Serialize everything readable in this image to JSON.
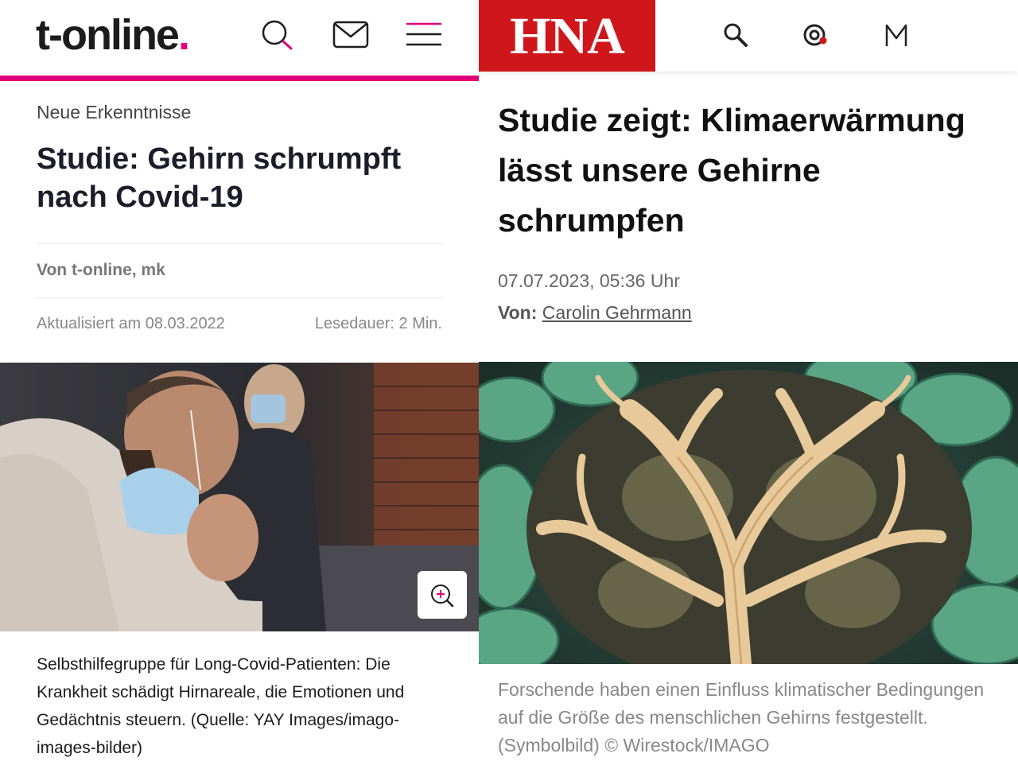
{
  "tonline": {
    "logo_text": "t-online",
    "logo_dot": ".",
    "kicker": "Neue Erkenntnisse",
    "title": "Studie: Gehirn schrumpft nach Covid-19",
    "author": "Von t-online, mk",
    "updated": "Aktualisiert am 08.03.2022",
    "read_time": "Lesedauer: 2 Min.",
    "caption": "Selbsthilfegruppe für Long-Covid-Patienten: Die Krankheit schädigt Hirnareale, die Emotionen und Gedächtnis steuern. (Quelle: YAY Images/imago-images-bilder)",
    "icons": [
      "search-icon",
      "mail-icon",
      "menu-icon",
      "zoom-in-icon"
    ],
    "accent_color": "#e2007a"
  },
  "hna": {
    "logo_text": "HNA",
    "title": "Studie zeigt: Klimaerwärmung lässt unsere Gehirne schrumpfen",
    "date": "07.07.2023, 05:36 Uhr",
    "byline_label": "Von:",
    "author": "Carolin Gehrmann",
    "caption": "Forschende haben einen Einfluss klimatischer Bedingungen auf die Größe des menschlichen Gehirns festgestellt. (Symbolbild) © Wirestock/IMAGO",
    "icons": [
      "search-icon",
      "podcast-icon",
      "account-icon"
    ],
    "brand_color": "#cf171b"
  }
}
